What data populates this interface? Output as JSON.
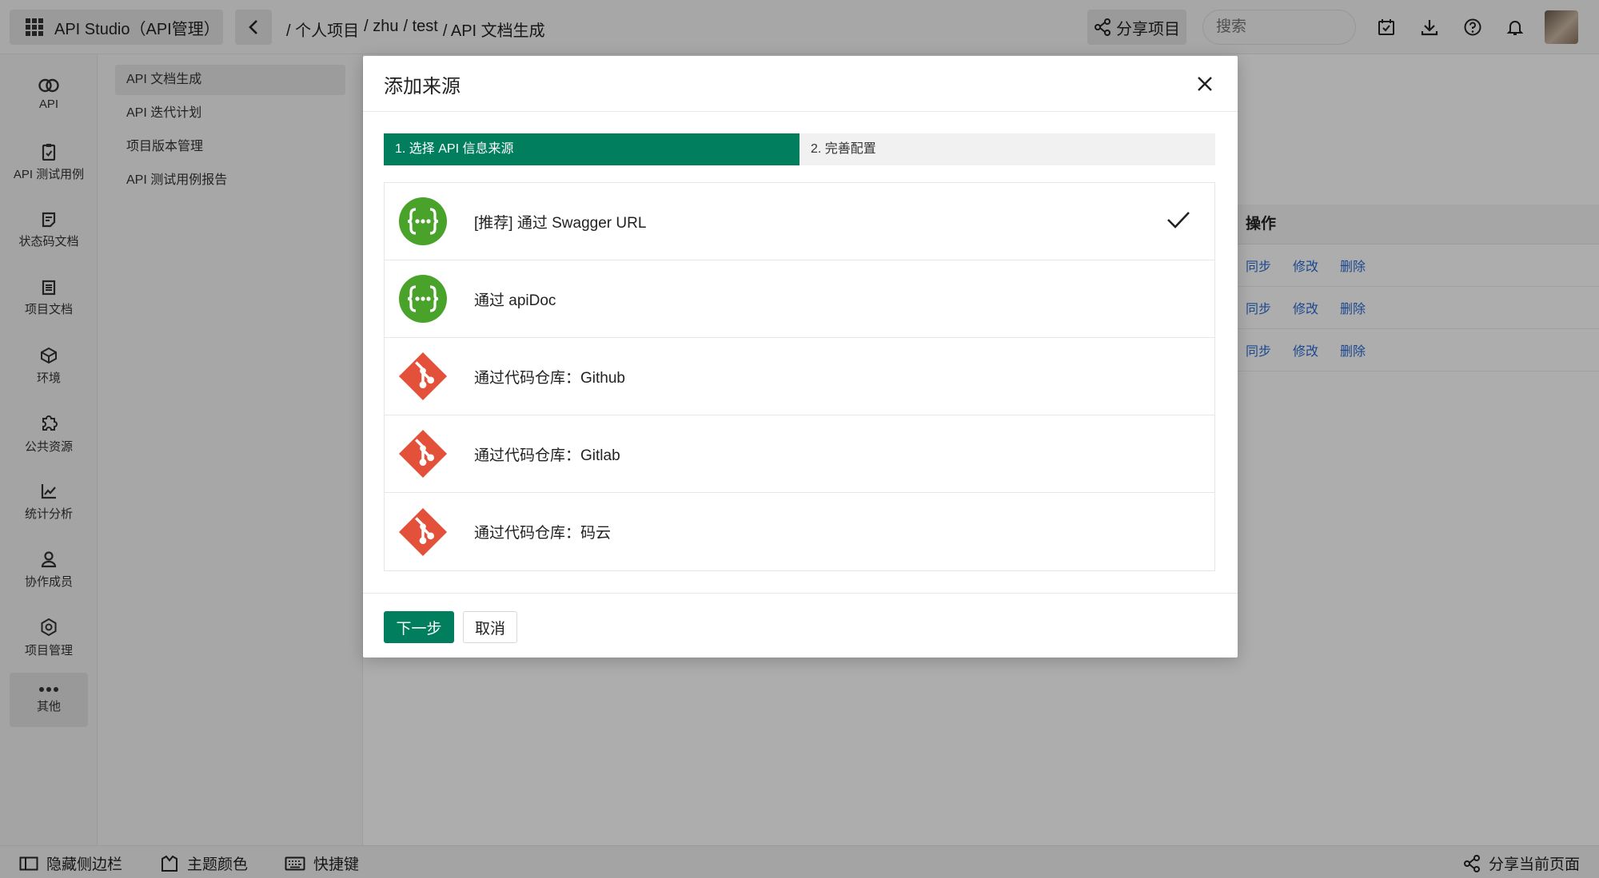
{
  "topbar": {
    "app_name": "API Studio（API管理）",
    "breadcrumb": [
      "/ 个人项目",
      "/ zhu",
      "/ test",
      "/ API 文档生成"
    ],
    "share_project": "分享项目",
    "search_placeholder": "搜索"
  },
  "iconbar": {
    "items": [
      {
        "label": "API",
        "icon": "link-icon"
      },
      {
        "label": "API 测试用例",
        "icon": "clipboard-icon"
      },
      {
        "label": "状态码文档",
        "icon": "note-icon"
      },
      {
        "label": "项目文档",
        "icon": "document-icon"
      },
      {
        "label": "环境",
        "icon": "cube-icon"
      },
      {
        "label": "公共资源",
        "icon": "puzzle-icon"
      },
      {
        "label": "统计分析",
        "icon": "chart-icon"
      },
      {
        "label": "协作成员",
        "icon": "user-icon"
      },
      {
        "label": "项目管理",
        "icon": "gear-icon"
      },
      {
        "label": "其他",
        "icon": "more-icon"
      }
    ]
  },
  "subnav": {
    "items": [
      "API 文档生成",
      "API 迭代计划",
      "项目版本管理",
      "API 测试用例报告"
    ]
  },
  "table": {
    "header": "操作",
    "rows": [
      {
        "sync": "同步",
        "edit": "修改",
        "delete": "删除"
      },
      {
        "sync": "同步",
        "edit": "修改",
        "delete": "删除"
      },
      {
        "sync": "同步",
        "edit": "修改",
        "delete": "删除"
      }
    ]
  },
  "bottombar": {
    "hide_sidebar": "隐藏侧边栏",
    "theme_color": "主题颜色",
    "shortcuts": "快捷键",
    "share_page": "分享当前页面"
  },
  "modal": {
    "title": "添加来源",
    "steps": [
      "1. 选择 API 信息来源",
      "2. 完善配置"
    ],
    "sources": [
      {
        "label": "[推荐] 通过 Swagger URL",
        "icon": "swagger-icon",
        "selected": true
      },
      {
        "label": "通过 apiDoc",
        "icon": "swagger-icon",
        "selected": false
      },
      {
        "label": "通过代码仓库：Github",
        "icon": "git-icon",
        "selected": false
      },
      {
        "label": "通过代码仓库：Gitlab",
        "icon": "git-icon",
        "selected": false
      },
      {
        "label": "通过代码仓库：码云",
        "icon": "git-icon",
        "selected": false
      }
    ],
    "next_button": "下一步",
    "cancel_button": "取消"
  },
  "colors": {
    "accent": "#007e5e",
    "swagger_green": "#49a32b",
    "git_red": "#e4513a",
    "link_blue": "#2a6ad2"
  }
}
